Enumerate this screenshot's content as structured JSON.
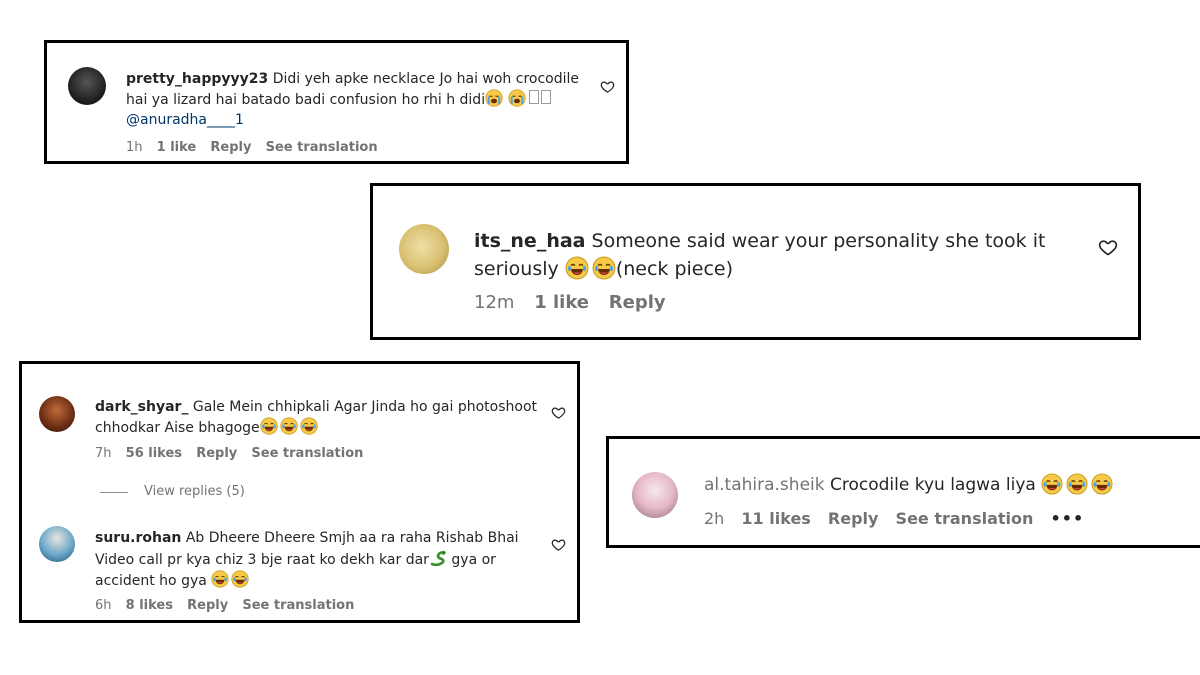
{
  "comments": [
    {
      "username": "pretty_happyyy23",
      "text_line1": "Didi yeh apke necklace Jo hai woh crocodile",
      "text_line2": "hai ya lizard hai batado badi confusion ho rhi h didi",
      "mention": "@anuradha____1",
      "time": "1h",
      "likes": "1 like",
      "reply": "Reply",
      "translate": "See translation"
    },
    {
      "username": "its_ne_haa",
      "text_line1": "Someone said wear your personality she took it",
      "text_line2_a": "seriously",
      "text_line2_b": "(neck piece)",
      "time": "12m",
      "likes": "1 like",
      "reply": "Reply"
    },
    {
      "username": "dark_shyar_",
      "text_line1": "Gale Mein chhipkali Agar Jinda ho gai photoshoot",
      "text_line2": "chhodkar Aise bhagoge",
      "time": "7h",
      "likes": "56 likes",
      "reply": "Reply",
      "translate": "See translation",
      "view_replies": "View replies (5)"
    },
    {
      "username": "suru.rohan",
      "text_line1": "Ab Dheere Dheere Smjh aa ra raha Rishab Bhai",
      "text_line2_a": "Video call pr kya chiz 3 bje raat ko dekh kar dar",
      "text_line2_b": "gya or",
      "text_line3": "accident ho gya",
      "time": "6h",
      "likes": "8 likes",
      "reply": "Reply",
      "translate": "See translation"
    },
    {
      "username": "al.tahira.sheik",
      "text": "Crocodile kyu lagwa liya",
      "time": "2h",
      "likes": "11 likes",
      "reply": "Reply",
      "translate": "See translation",
      "more": "•••"
    }
  ],
  "icons": {
    "heart": "heart-outline-icon",
    "laugh": "face-with-tears-of-joy-icon",
    "cry": "loudly-crying-face-icon",
    "snake": "snake-icon"
  },
  "colors": {
    "text": "#262626",
    "meta": "#737373",
    "border": "#000000",
    "emoji": "#f7c948"
  }
}
